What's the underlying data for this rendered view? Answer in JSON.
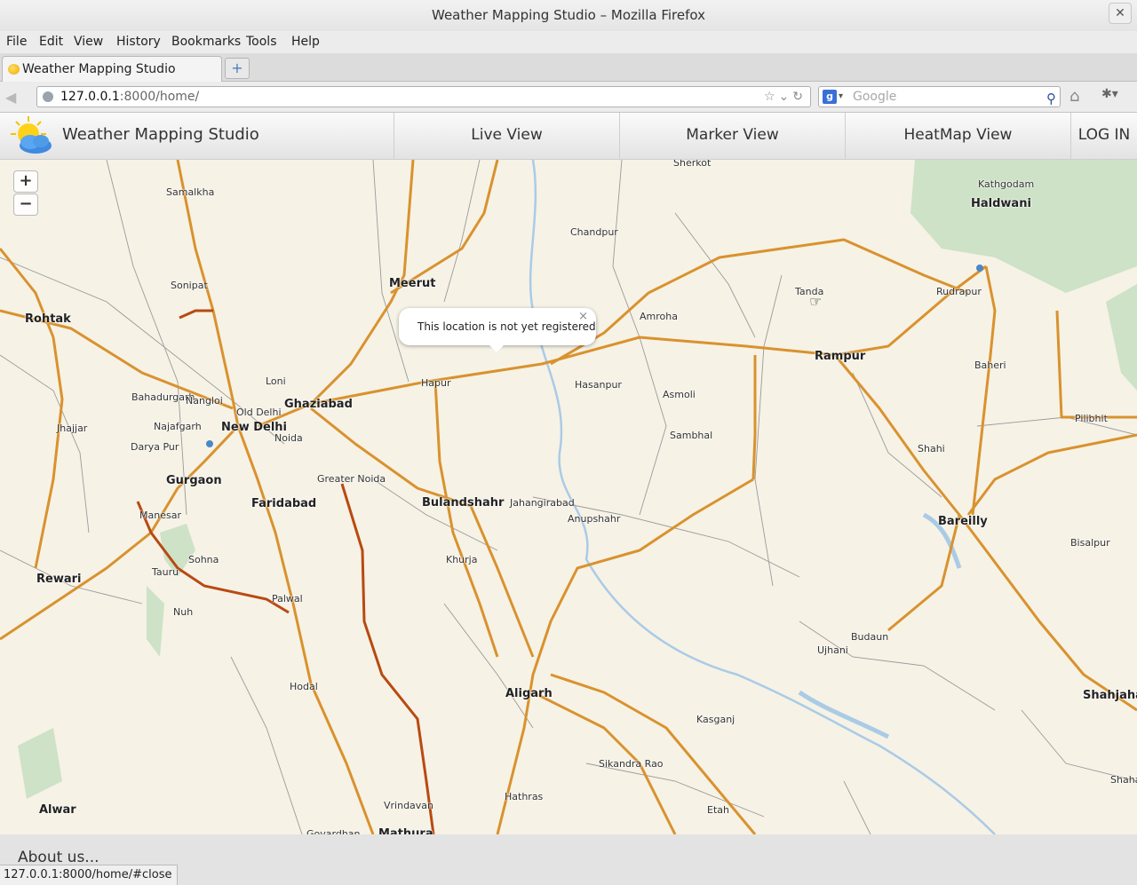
{
  "window": {
    "title": "Weather Mapping Studio – Mozilla Firefox",
    "close_glyph": "✕"
  },
  "menu": [
    "File",
    "Edit",
    "View",
    "History",
    "Bookmarks",
    "Tools",
    "Help"
  ],
  "tab": {
    "label": "Weather Mapping Studio",
    "newtab_glyph": "+"
  },
  "urlbar": {
    "host": "127.0.0.1",
    "path": ":8000/home/"
  },
  "search": {
    "placeholder": "Google",
    "engine_glyph": "g"
  },
  "app": {
    "name": "Weather Mapping Studio",
    "nav": [
      "Live View",
      "Marker View",
      "HeatMap View",
      "LOG IN"
    ]
  },
  "map": {
    "zoom_in": "+",
    "zoom_out": "−",
    "popup_text": "This location is not yet registered",
    "popup_close": "×",
    "places": [
      {
        "name": "Sherkot",
        "big": false
      },
      {
        "name": "Kathgodam",
        "big": false
      },
      {
        "name": "Haldwani",
        "big": true
      },
      {
        "name": "Samalkha",
        "big": false
      },
      {
        "name": "Chandpur",
        "big": false
      },
      {
        "name": "Sonipat",
        "big": false
      },
      {
        "name": "Meerut",
        "big": true
      },
      {
        "name": "Tanda",
        "big": false
      },
      {
        "name": "Rudrapur",
        "big": false
      },
      {
        "name": "Rohtak",
        "big": true
      },
      {
        "name": "Amroha",
        "big": false
      },
      {
        "name": "Rampur",
        "big": true
      },
      {
        "name": "Baheri",
        "big": false
      },
      {
        "name": "Loni",
        "big": false
      },
      {
        "name": "Hapur",
        "big": false
      },
      {
        "name": "Hasanpur",
        "big": false
      },
      {
        "name": "Bahadurgarh",
        "big": false
      },
      {
        "name": "Nangloi",
        "big": false
      },
      {
        "name": "Ghaziabad",
        "big": true
      },
      {
        "name": "Asmoli",
        "big": false
      },
      {
        "name": "Old Delhi",
        "big": false
      },
      {
        "name": "Pilibhit",
        "big": false
      },
      {
        "name": "Jhajjar",
        "big": false
      },
      {
        "name": "Najafgarh",
        "big": false
      },
      {
        "name": "New Delhi",
        "big": true
      },
      {
        "name": "Sambhal",
        "big": false
      },
      {
        "name": "Noida",
        "big": false
      },
      {
        "name": "Darya Pur",
        "big": false
      },
      {
        "name": "Shahi",
        "big": false
      },
      {
        "name": "Gurgaon",
        "big": true
      },
      {
        "name": "Greater Noida",
        "big": false
      },
      {
        "name": "Faridabad",
        "big": true
      },
      {
        "name": "Bulandshahr",
        "big": true
      },
      {
        "name": "Jahangirabad",
        "big": false
      },
      {
        "name": "Manesar",
        "big": false
      },
      {
        "name": "Anupshahr",
        "big": false
      },
      {
        "name": "Bareilly",
        "big": true
      },
      {
        "name": "Bisalpur",
        "big": false
      },
      {
        "name": "Khurja",
        "big": false
      },
      {
        "name": "Sohna",
        "big": false
      },
      {
        "name": "Tauru",
        "big": false
      },
      {
        "name": "Rewari",
        "big": true
      },
      {
        "name": "Palwal",
        "big": false
      },
      {
        "name": "Nuh",
        "big": false
      },
      {
        "name": "Budaun",
        "big": false
      },
      {
        "name": "Ujhani",
        "big": false
      },
      {
        "name": "Hodal",
        "big": false
      },
      {
        "name": "Aligarh",
        "big": true
      },
      {
        "name": "Shahjahanpur",
        "big": true
      },
      {
        "name": "Kasganj",
        "big": false
      },
      {
        "name": "Sikandra Rao",
        "big": false
      },
      {
        "name": "Shaha",
        "big": false
      },
      {
        "name": "Hathras",
        "big": false
      },
      {
        "name": "Alwar",
        "big": true
      },
      {
        "name": "Vrindavan",
        "big": false
      },
      {
        "name": "Etah",
        "big": false
      },
      {
        "name": "Govardhan",
        "big": false
      },
      {
        "name": "Mathura",
        "big": true
      }
    ]
  },
  "footer": {
    "about": "About us..."
  },
  "status": {
    "url": "127.0.0.1:8000/home/#close"
  }
}
